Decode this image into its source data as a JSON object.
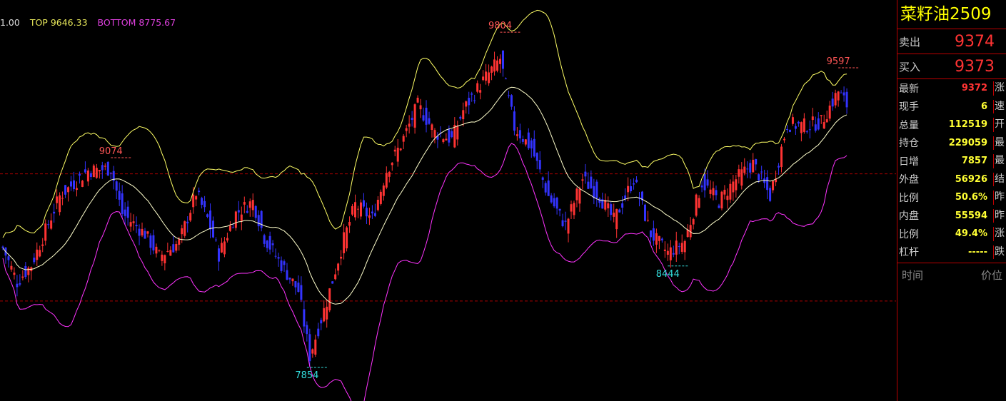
{
  "indicator": {
    "mid_value": "1.00",
    "top_label": "TOP",
    "top_value": "9646.33",
    "bottom_label": "BOTTOM",
    "bottom_value": "8775.67"
  },
  "panel": {
    "symbol": "菜籽油2509",
    "ask_label": "卖出",
    "ask_value": "9374",
    "bid_label": "买入",
    "bid_value": "9373",
    "rows": [
      {
        "label": "最新",
        "value": "9372",
        "color": "#ff3333",
        "cut": "涨"
      },
      {
        "label": "现手",
        "value": "6",
        "color": "#ffff33",
        "cut": "速"
      },
      {
        "label": "总量",
        "value": "112519",
        "color": "#ffff33",
        "cut": "开"
      },
      {
        "label": "持仓",
        "value": "229059",
        "color": "#ffff33",
        "cut": "最"
      },
      {
        "label": "日增",
        "value": "7857",
        "color": "#ffff33",
        "cut": "最"
      },
      {
        "label": "外盘",
        "value": "56926",
        "color": "#ffff33",
        "cut": "结"
      },
      {
        "label": "比例",
        "value": "50.6%",
        "color": "#ffff33",
        "cut": "昨"
      },
      {
        "label": "内盘",
        "value": "55594",
        "color": "#ffff33",
        "cut": "昨"
      },
      {
        "label": "比例",
        "value": "49.4%",
        "color": "#ffff33",
        "cut": "涨"
      },
      {
        "label": "杠杆",
        "value": "-----",
        "color": "#ffff33",
        "cut": "跌"
      }
    ],
    "tick_time_label": "时间",
    "tick_price_label": "价位"
  },
  "chart_data": {
    "type": "candlestick",
    "price_range": [
      7700,
      9950
    ],
    "colors": {
      "up": "#ff3333",
      "down": "#3333ff",
      "upper_band": "#ffff66",
      "middle_band": "#ffffcc",
      "lower_band": "#ff33ff",
      "hline": "#aa0000",
      "high_label": "#ff5555",
      "low_label": "#33dddd"
    },
    "annotations": [
      {
        "text": "9074",
        "value": 9074,
        "kind": "high",
        "at_candle": 38
      },
      {
        "text": "7854",
        "value": 7854,
        "kind": "low",
        "at_candle": 107
      },
      {
        "text": "9804",
        "value": 9804,
        "kind": "high",
        "at_candle": 175
      },
      {
        "text": "8444",
        "value": 8444,
        "kind": "low",
        "at_candle": 234
      },
      {
        "text": "9597",
        "value": 9597,
        "kind": "high",
        "at_candle": 294
      }
    ],
    "reference_lines": [
      8980,
      8240
    ],
    "waypoints": [
      [
        0,
        8550
      ],
      [
        5,
        8350
      ],
      [
        10,
        8450
      ],
      [
        20,
        8850
      ],
      [
        30,
        9000
      ],
      [
        38,
        9010
      ],
      [
        42,
        8750
      ],
      [
        50,
        8630
      ],
      [
        55,
        8500
      ],
      [
        62,
        8580
      ],
      [
        68,
        8870
      ],
      [
        72,
        8720
      ],
      [
        76,
        8510
      ],
      [
        82,
        8750
      ],
      [
        88,
        8820
      ],
      [
        92,
        8610
      ],
      [
        98,
        8450
      ],
      [
        104,
        8300
      ],
      [
        108,
        7920
      ],
      [
        114,
        8240
      ],
      [
        120,
        8600
      ],
      [
        124,
        8800
      ],
      [
        130,
        8720
      ],
      [
        135,
        9000
      ],
      [
        140,
        9150
      ],
      [
        146,
        9380
      ],
      [
        152,
        9220
      ],
      [
        158,
        9180
      ],
      [
        162,
        9350
      ],
      [
        168,
        9500
      ],
      [
        175,
        9650
      ],
      [
        180,
        9250
      ],
      [
        186,
        9130
      ],
      [
        192,
        8850
      ],
      [
        198,
        8680
      ],
      [
        204,
        8950
      ],
      [
        210,
        8850
      ],
      [
        215,
        8710
      ],
      [
        222,
        8950
      ],
      [
        228,
        8630
      ],
      [
        234,
        8520
      ],
      [
        240,
        8590
      ],
      [
        246,
        8930
      ],
      [
        252,
        8820
      ],
      [
        258,
        8950
      ],
      [
        264,
        9040
      ],
      [
        270,
        8850
      ],
      [
        276,
        9270
      ],
      [
        282,
        9260
      ],
      [
        288,
        9280
      ],
      [
        294,
        9460
      ],
      [
        297,
        9380
      ]
    ]
  }
}
